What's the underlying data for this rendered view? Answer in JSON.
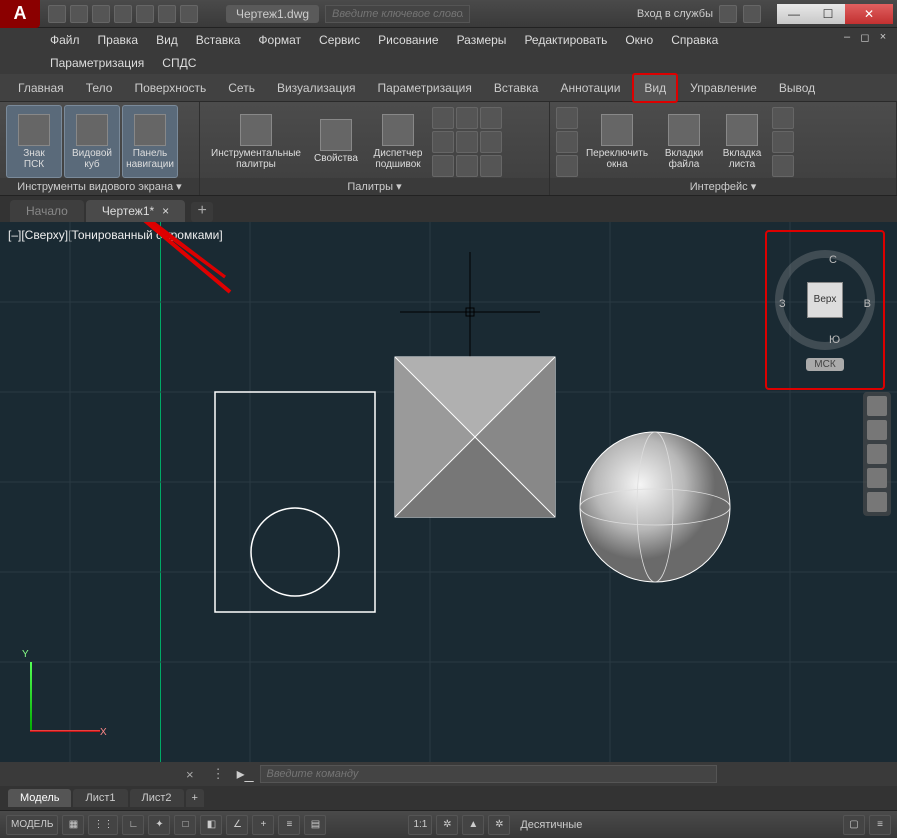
{
  "titlebar": {
    "filename": "Чертеж1.dwg",
    "search_placeholder": "Введите ключевое слово/фразу",
    "signin": "Вход в службы"
  },
  "menus": {
    "row1": [
      "Файл",
      "Правка",
      "Вид",
      "Вставка",
      "Формат",
      "Сервис",
      "Рисование",
      "Размеры",
      "Редактировать",
      "Окно",
      "Справка"
    ],
    "row2": [
      "Параметризация",
      "СПДС"
    ]
  },
  "ribbon_tabs": [
    "Главная",
    "Тело",
    "Поверхность",
    "Сеть",
    "Визуализация",
    "Параметризация",
    "Вставка",
    "Аннотации",
    "Вид",
    "Управление",
    "Вывод"
  ],
  "ribbon_active_tab": "Вид",
  "ribbon": {
    "group1": {
      "title": "Инструменты видового экрана ▾",
      "btn1": "Знак\nПСК",
      "btn2": "Видовой\nкуб",
      "btn3": "Панель\nнавигации"
    },
    "group2": {
      "title": "Палитры ▾",
      "btn1": "Инструментальные\nпалитры",
      "btn2": "Свойства",
      "btn3": "Диспетчер\nподшивок"
    },
    "group3": {
      "title": "Интерфейс ▾",
      "btn1": "Переключить\nокна",
      "btn2": "Вкладки\nфайла",
      "btn3": "Вкладка\nлиста"
    }
  },
  "doc_tabs": {
    "t0": "Начало",
    "t1": "Чертеж1*"
  },
  "viewport": {
    "label": "[–][Сверху][Тонированный с кромками]",
    "viewcube": {
      "n": "С",
      "s": "Ю",
      "e": "В",
      "w": "З",
      "face": "Верх",
      "wcs": "МСК"
    },
    "axis_x": "X",
    "axis_y": "Y"
  },
  "cmdline": {
    "placeholder": "Введите команду"
  },
  "layout_tabs": [
    "Модель",
    "Лист1",
    "Лист2"
  ],
  "statusbar": {
    "model": "МОДЕЛЬ",
    "scale": "1:1",
    "units": "Десятичные"
  }
}
